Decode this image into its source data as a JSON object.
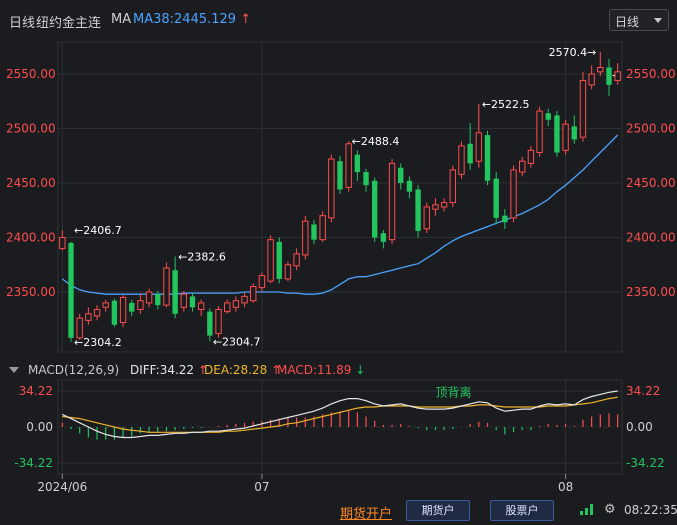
{
  "toolbar": {
    "period_label": "日线",
    "instrument": "纽约金主连",
    "ma_label": "MA",
    "ma38_label": "MA38:2445.129",
    "ma38_arrow": "↑",
    "period_select_value": "日线"
  },
  "price_axis": {
    "ticks": [
      "2550.00",
      "2500.00",
      "2450.00",
      "2400.00",
      "2350.00"
    ],
    "current_marker": "◄"
  },
  "annotations": [
    "2406.7",
    "2304.2",
    "2382.6",
    "2304.7",
    "2488.4",
    "2522.5",
    "2570.4"
  ],
  "macd": {
    "title": "MACD(12,26,9)",
    "diff_label": "DIFF:34.22",
    "diff_arrow": "↑",
    "dea_label": "DEA:28.28",
    "dea_arrow": "↑",
    "macd_label": "MACD:11.89",
    "macd_arrow": "↓",
    "axis_ticks": [
      "34.22",
      "0.00",
      "-34.22"
    ],
    "divergence_label": "顶背离"
  },
  "x_axis": {
    "labels": [
      "2024/06",
      "07",
      "08"
    ]
  },
  "footer": {
    "futures_link": "期货开户",
    "futures_btn": "期货户",
    "stock_btn": "股票户",
    "time": "08:22:35"
  },
  "colors": {
    "up": "#ff4d4d",
    "down": "#22c55e",
    "ma38": "#4aa3ff",
    "dea": "#f0b429",
    "diff": "#e6e6e6",
    "background": "#1b1c20",
    "accent": "#ff8a1f"
  },
  "chart_data": {
    "type": "candlestick",
    "x_labels": [
      "2024/06",
      "07",
      "08"
    ],
    "ylim": [
      2300,
      2580
    ],
    "candles": [
      [
        2390,
        2400,
        2388,
        2406.7
      ],
      [
        2395,
        2308,
        2304.2,
        2396
      ],
      [
        2308,
        2326,
        2306,
        2330
      ],
      [
        2324,
        2330,
        2320,
        2336
      ],
      [
        2328,
        2334,
        2324,
        2338
      ],
      [
        2336,
        2340,
        2332,
        2343
      ],
      [
        2342,
        2320,
        2318,
        2344
      ],
      [
        2322,
        2345,
        2318,
        2347
      ],
      [
        2340,
        2332,
        2328,
        2343
      ],
      [
        2334,
        2342,
        2330,
        2349
      ],
      [
        2340,
        2350,
        2336,
        2353
      ],
      [
        2348,
        2338,
        2334,
        2351
      ],
      [
        2338,
        2372,
        2336,
        2377
      ],
      [
        2370,
        2330,
        2326,
        2382.6
      ],
      [
        2336,
        2348,
        2332,
        2351
      ],
      [
        2346,
        2336,
        2332,
        2349
      ],
      [
        2334,
        2340,
        2328,
        2343
      ],
      [
        2332,
        2310,
        2304.7,
        2335
      ],
      [
        2312,
        2334,
        2308,
        2337
      ],
      [
        2332,
        2340,
        2330,
        2343
      ],
      [
        2336,
        2342,
        2332,
        2346
      ],
      [
        2340,
        2346,
        2336,
        2349
      ],
      [
        2342,
        2355,
        2340,
        2358
      ],
      [
        2354,
        2365,
        2350,
        2368
      ],
      [
        2360,
        2398,
        2358,
        2402
      ],
      [
        2396,
        2362,
        2358,
        2400
      ],
      [
        2362,
        2375,
        2360,
        2378
      ],
      [
        2374,
        2385,
        2370,
        2390
      ],
      [
        2384,
        2415,
        2380,
        2420
      ],
      [
        2412,
        2398,
        2394,
        2416
      ],
      [
        2398,
        2420,
        2396,
        2424
      ],
      [
        2418,
        2472,
        2414,
        2476
      ],
      [
        2470,
        2444,
        2440,
        2475
      ],
      [
        2446,
        2486,
        2442,
        2488.4
      ],
      [
        2476,
        2460,
        2452,
        2480
      ],
      [
        2460,
        2448,
        2442,
        2463
      ],
      [
        2452,
        2400,
        2396,
        2455
      ],
      [
        2404,
        2396,
        2390,
        2407
      ],
      [
        2398,
        2468,
        2394,
        2472
      ],
      [
        2464,
        2450,
        2444,
        2468
      ],
      [
        2452,
        2442,
        2436,
        2456
      ],
      [
        2444,
        2406,
        2400,
        2448
      ],
      [
        2408,
        2428,
        2404,
        2432
      ],
      [
        2426,
        2430,
        2420,
        2436
      ],
      [
        2428,
        2432,
        2424,
        2436
      ],
      [
        2432,
        2462,
        2428,
        2466
      ],
      [
        2458,
        2484,
        2454,
        2488
      ],
      [
        2486,
        2468,
        2462,
        2505
      ],
      [
        2470,
        2496,
        2464,
        2522.5
      ],
      [
        2494,
        2452,
        2448,
        2498
      ],
      [
        2454,
        2418,
        2412,
        2460
      ],
      [
        2420,
        2414,
        2408,
        2426
      ],
      [
        2418,
        2462,
        2414,
        2466
      ],
      [
        2460,
        2470,
        2456,
        2474
      ],
      [
        2468,
        2480,
        2464,
        2484
      ],
      [
        2478,
        2516,
        2474,
        2520
      ],
      [
        2514,
        2508,
        2502,
        2518
      ],
      [
        2512,
        2478,
        2474,
        2516
      ],
      [
        2480,
        2504,
        2476,
        2508
      ],
      [
        2502,
        2490,
        2486,
        2512
      ],
      [
        2492,
        2544,
        2488,
        2552
      ],
      [
        2540,
        2550,
        2536,
        2558
      ],
      [
        2552,
        2556,
        2548,
        2570.4
      ],
      [
        2556,
        2540,
        2530,
        2564
      ],
      [
        2544,
        2552,
        2540,
        2560
      ]
    ],
    "ma38": [
      2362,
      2356,
      2352,
      2350,
      2349,
      2348,
      2348,
      2348,
      2348,
      2348,
      2348,
      2348,
      2348,
      2348,
      2349,
      2349,
      2349,
      2349,
      2349,
      2349,
      2349,
      2350,
      2350,
      2350,
      2350,
      2350,
      2349,
      2349,
      2348,
      2348,
      2349,
      2352,
      2357,
      2362,
      2364,
      2364,
      2366,
      2368,
      2370,
      2372,
      2374,
      2376,
      2381,
      2386,
      2392,
      2397,
      2401,
      2404,
      2407,
      2410,
      2413,
      2416,
      2419,
      2422,
      2426,
      2430,
      2435,
      2442,
      2448,
      2455,
      2462,
      2470,
      2478,
      2486,
      2494
    ],
    "macd_series": {
      "diff": [
        12,
        8,
        4,
        0,
        -4,
        -7,
        -9,
        -10,
        -10,
        -9,
        -8,
        -8,
        -7,
        -6,
        -6,
        -5,
        -5,
        -4,
        -4,
        -3,
        -2,
        -1,
        1,
        3,
        5,
        7,
        9,
        11,
        13,
        15,
        18,
        22,
        25,
        27,
        27,
        25,
        22,
        20,
        21,
        22,
        20,
        18,
        17,
        17,
        17,
        18,
        20,
        22,
        24,
        23,
        18,
        15,
        16,
        17,
        17,
        20,
        22,
        21,
        22,
        21,
        26,
        29,
        31,
        33,
        34.22
      ],
      "dea": [
        10,
        9,
        8,
        6,
        4,
        2,
        0,
        -2,
        -3,
        -4,
        -5,
        -5,
        -5,
        -5,
        -5,
        -5,
        -5,
        -5,
        -5,
        -4,
        -4,
        -3,
        -2,
        -1,
        0,
        1,
        3,
        4,
        6,
        8,
        10,
        12,
        14,
        16,
        18,
        19,
        19,
        20,
        20,
        20,
        20,
        19,
        19,
        19,
        19,
        19,
        20,
        20,
        21,
        21,
        20,
        19,
        19,
        19,
        19,
        19,
        20,
        20,
        20,
        21,
        22,
        23,
        25,
        27,
        28.28
      ],
      "hist": [
        4,
        -2,
        -6,
        -10,
        -12,
        -12,
        -12,
        -10,
        -9,
        -6,
        -5,
        -5,
        -4,
        -3,
        -2,
        -1,
        -1,
        0,
        1,
        2,
        3,
        4,
        5,
        6,
        7,
        8,
        9,
        9,
        9,
        10,
        12,
        14,
        15,
        16,
        14,
        10,
        6,
        2,
        2,
        3,
        1,
        -1,
        -3,
        -3,
        -3,
        -2,
        0,
        3,
        5,
        4,
        -3,
        -7,
        -5,
        -3,
        -3,
        1,
        3,
        2,
        3,
        1,
        7,
        10,
        12,
        13,
        11.89
      ]
    }
  }
}
